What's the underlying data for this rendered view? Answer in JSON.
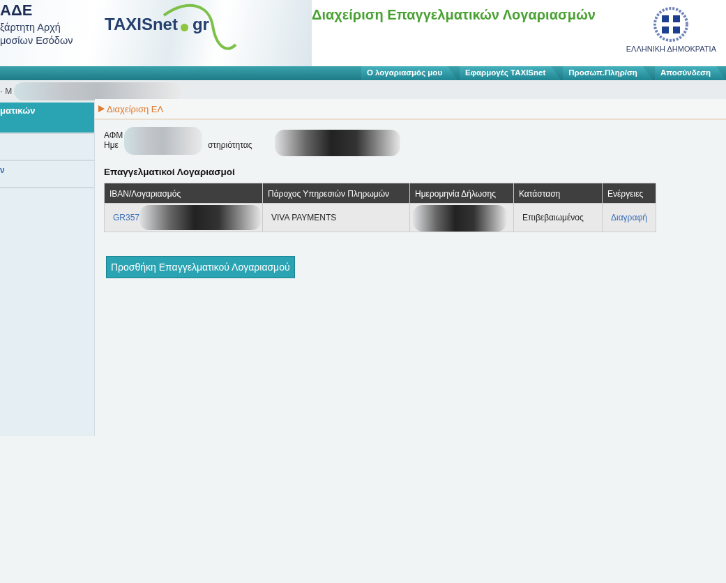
{
  "header": {
    "agency_lines": [
      "ΑΔΕ",
      "ξάρτητη Αρχή",
      "μοσίων Εσόδων"
    ],
    "logo": {
      "name": "TAXISnet",
      "domain": "gr"
    },
    "title": "Διαχείριση Επαγγελματικών Λογαριασμών",
    "republic": "ΕΛΛΗΝΙΚΗ ΔΗΜΟΚΡΑΤΙΑ"
  },
  "nav_tabs": [
    {
      "label": "Ο λογαριασμός μου"
    },
    {
      "label": "Εφαρμογές TAXISnet"
    },
    {
      "label": "Προσωπ.Πληρ/ση"
    },
    {
      "label": "Αποσύνδεση"
    }
  ],
  "breadcrumb": "· M",
  "sidebar": {
    "items": [
      {
        "label": "ματικών",
        "selected": true
      },
      {
        "selected": false
      },
      {
        "label": "ν",
        "selected": false
      }
    ]
  },
  "section_title": "Διαχείριση ΕΛ",
  "info": {
    "afm_label": "ΑΦΜ",
    "date_label_start": "Ημε",
    "date_label_end": "στηριότητας"
  },
  "accounts": {
    "title": "Επαγγελματικοί Λογαριασμοί",
    "columns": [
      "IBAN/Λογαριασμός",
      "Πάροχος Υπηρεσιών Πληρωμών",
      "Ημερομηνία Δήλωσης",
      "Κατάσταση",
      "Ενέργειες"
    ],
    "rows": [
      {
        "iban": "GR357",
        "provider": "VIVA PAYMENTS",
        "status": "Επιβεβαιωμένος",
        "action": "Διαγραφή"
      }
    ]
  },
  "add_button": "Προσθήκη Επαγγελματικού Λογαριασμού"
}
